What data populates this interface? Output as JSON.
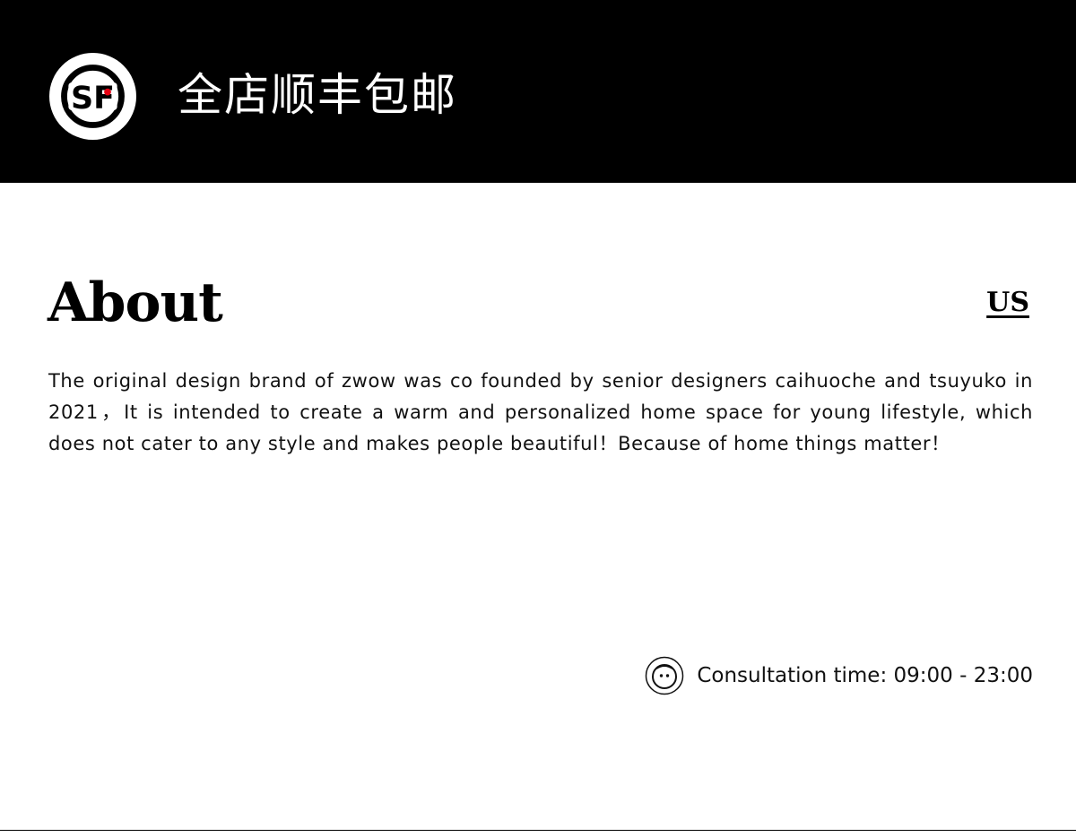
{
  "banner": {
    "shipping_text": "全店顺丰包邮",
    "logo_icon": "sf-express-logo-icon",
    "background_color": "#000000"
  },
  "about": {
    "title": "About",
    "us_link": "US",
    "description": "The original design brand of zwow was co founded by senior designers caihuoche and tsuyuko in 2021，It is intended to create a warm and personalized home space for young lifestyle, which does not cater to any style and makes people beautiful！Because of home things matter！"
  },
  "consultation": {
    "icon": "customer-service-face-icon",
    "text": "Consultation time: 09:00 - 23:00"
  }
}
